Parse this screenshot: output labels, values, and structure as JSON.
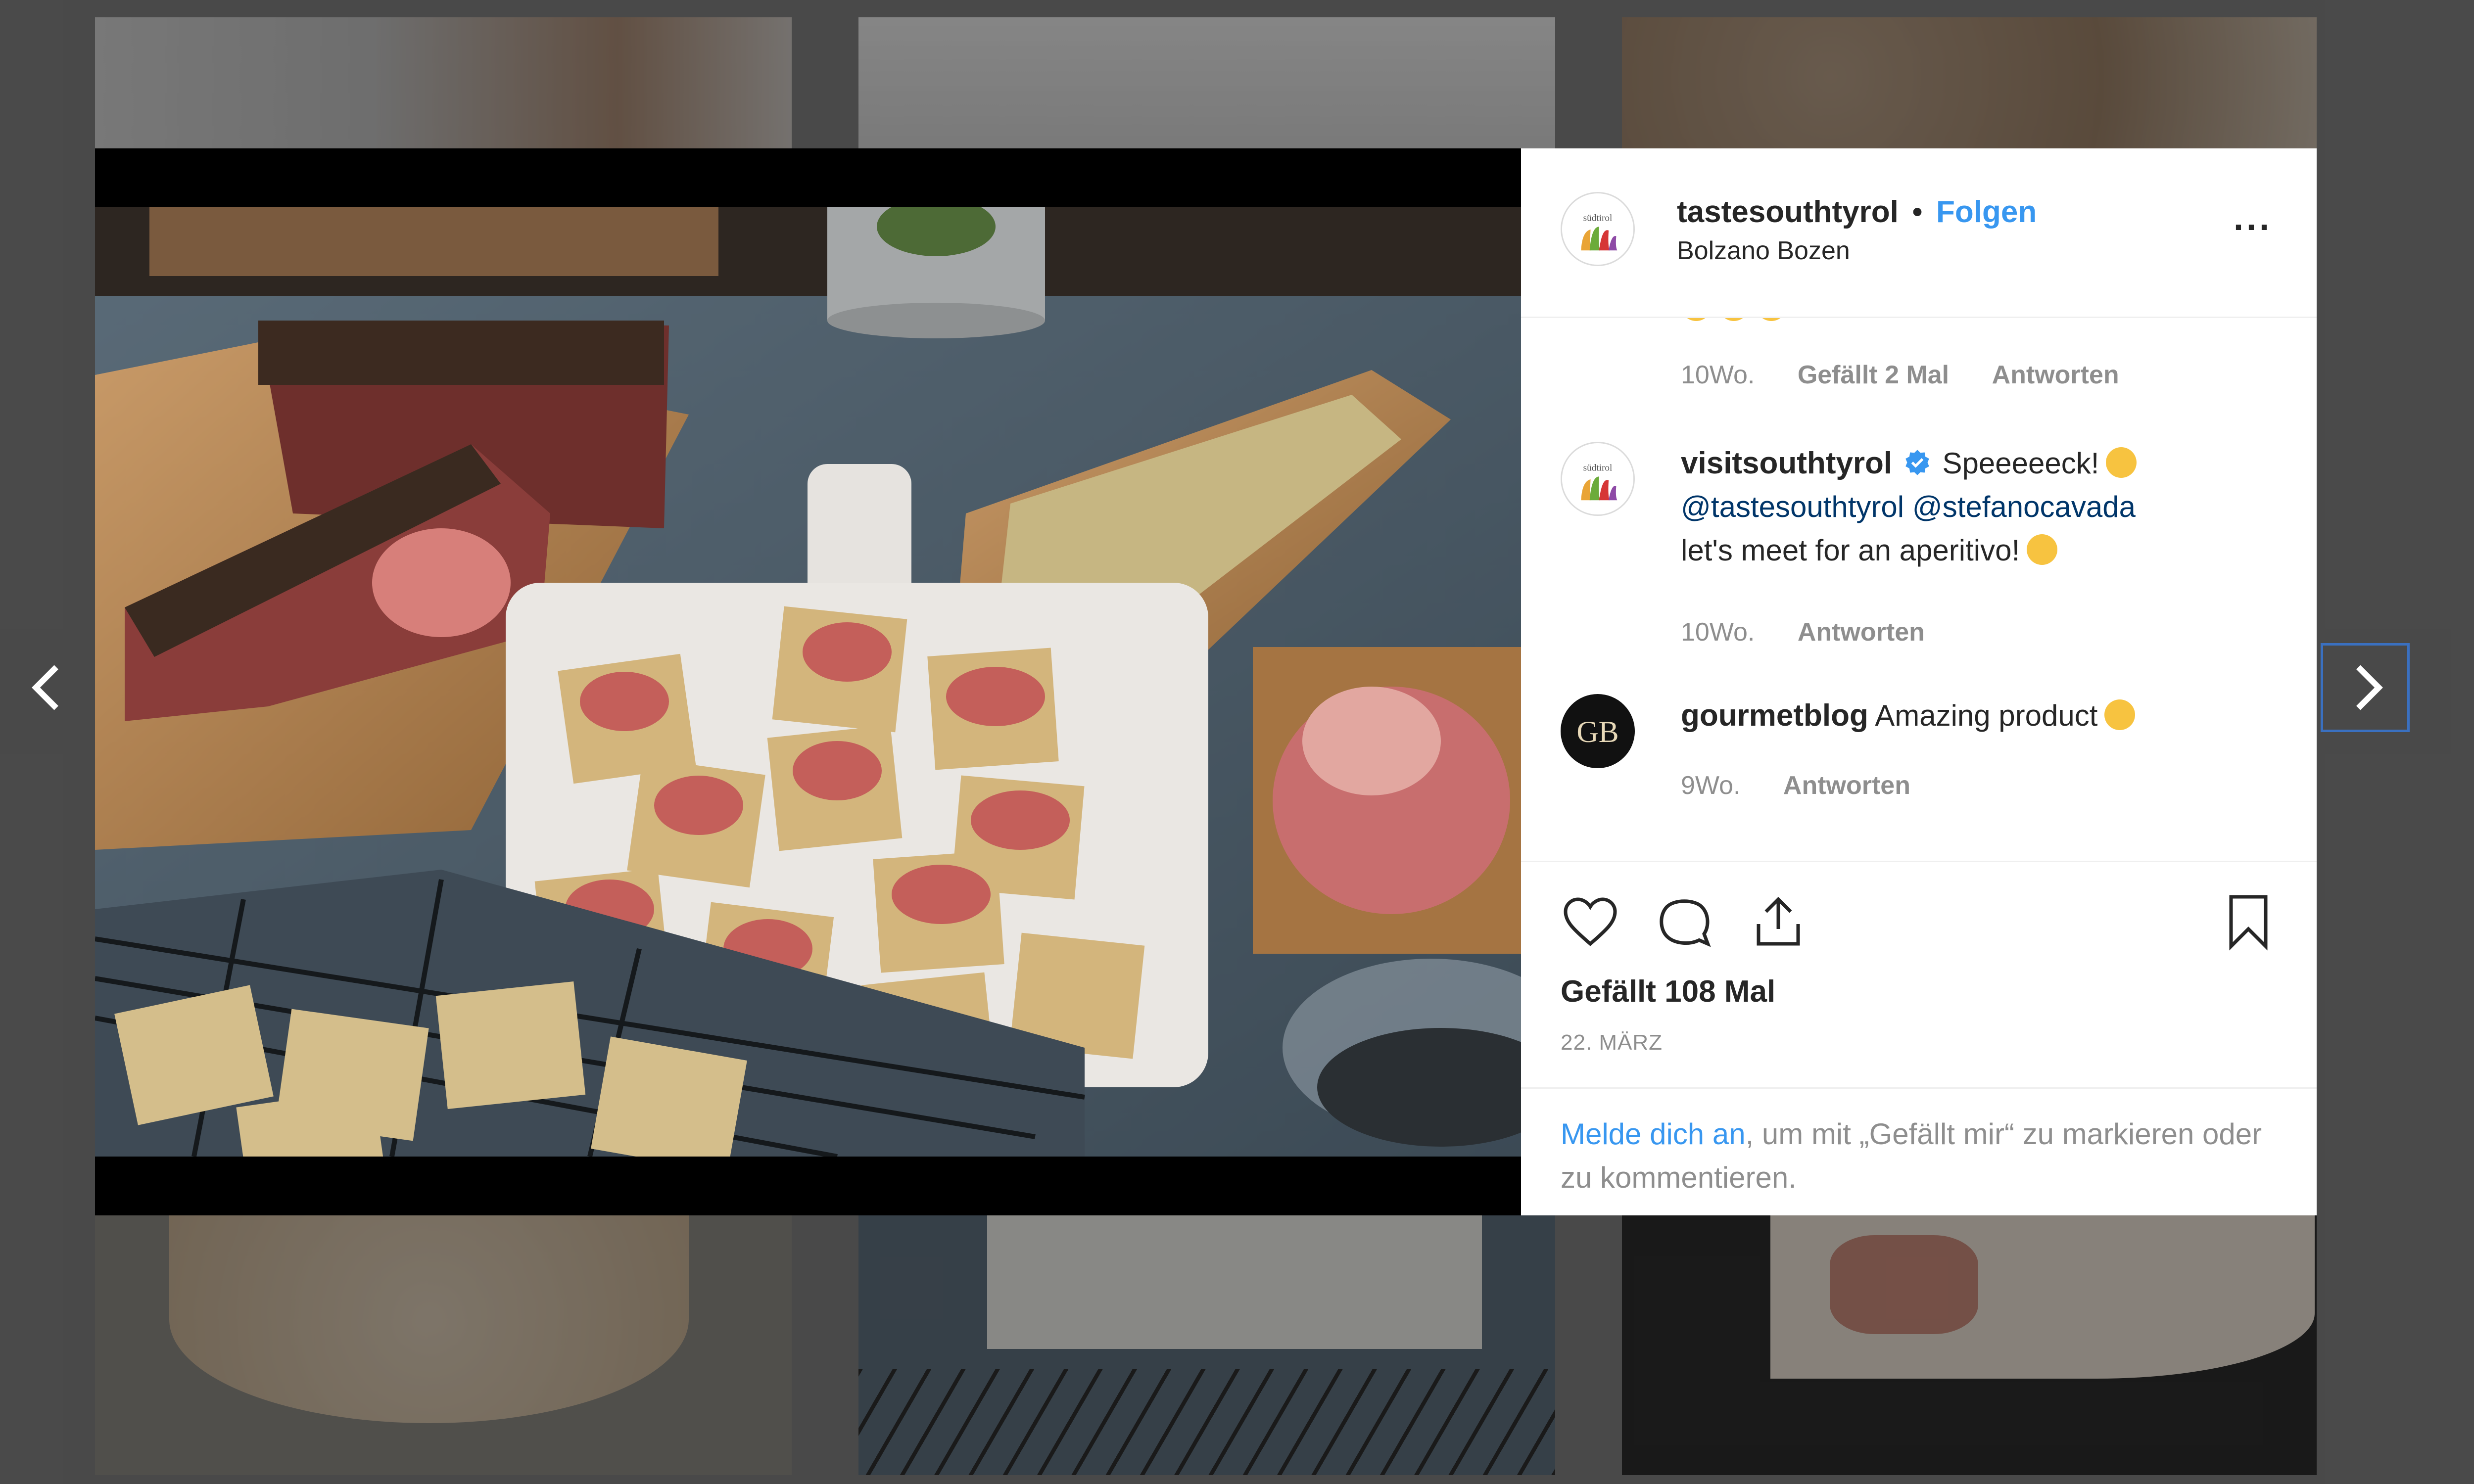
{
  "post": {
    "author": "tastesouthtyrol",
    "separator": "•",
    "follow_label": "Folgen",
    "location": "Bolzano Bozen",
    "more_label": "...",
    "likes": "Gefällt 108 Mal",
    "date": "22. MÄRZ",
    "avatar_text": "südtirol"
  },
  "comments": [
    {
      "meta": {
        "time": "10Wo.",
        "likes": "Gefällt 2 Mal",
        "reply": "Antworten"
      }
    },
    {
      "username": "visitsouthtyrol",
      "verified": true,
      "text": "Speeeeeck!",
      "mention1": "@tastesouthtyrol",
      "mention2": "@stefanocavada",
      "text2": "let's meet for an aperitivo!",
      "meta": {
        "time": "10Wo.",
        "reply": "Antworten"
      },
      "avatar_text": "südtirol"
    },
    {
      "username": "gourmetblog",
      "text": "Amazing product",
      "meta": {
        "time": "9Wo.",
        "reply": "Antworten"
      },
      "avatar_initials": "GB"
    }
  ],
  "login_prompt": {
    "link": "Melde dich an",
    "rest": ", um mit „Gefällt mir“ zu markieren oder zu kommentieren."
  },
  "icons": [
    "heart-icon",
    "comment-icon",
    "share-icon",
    "bookmark-icon",
    "chevron-left-icon",
    "chevron-right-icon",
    "verified-icon"
  ],
  "colors": {
    "follow": "#3897f0",
    "link": "#003569",
    "meta": "#8e8e8e",
    "backdrop": "#7f7f7f",
    "verified": "#3897f0"
  }
}
